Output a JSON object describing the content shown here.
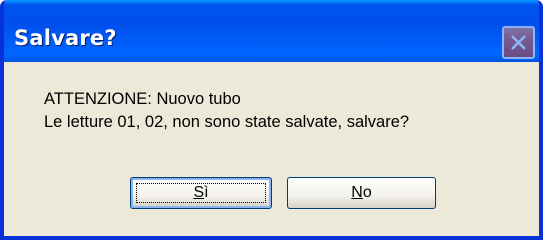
{
  "dialog": {
    "title": "Salvare?",
    "message_lines": [
      "ATTENZIONE: Nuovo tubo",
      "Le letture 01, 02,  non sono state salvate, salvare?"
    ],
    "buttons": {
      "yes": {
        "mnemonic": "S",
        "rest": "ì"
      },
      "no": {
        "mnemonic": "N",
        "rest": "o"
      }
    },
    "close_icon": "close-icon"
  },
  "colors": {
    "titlebar": "#0054e3",
    "window_background": "#ece9d8",
    "button_border": "#003c74"
  }
}
